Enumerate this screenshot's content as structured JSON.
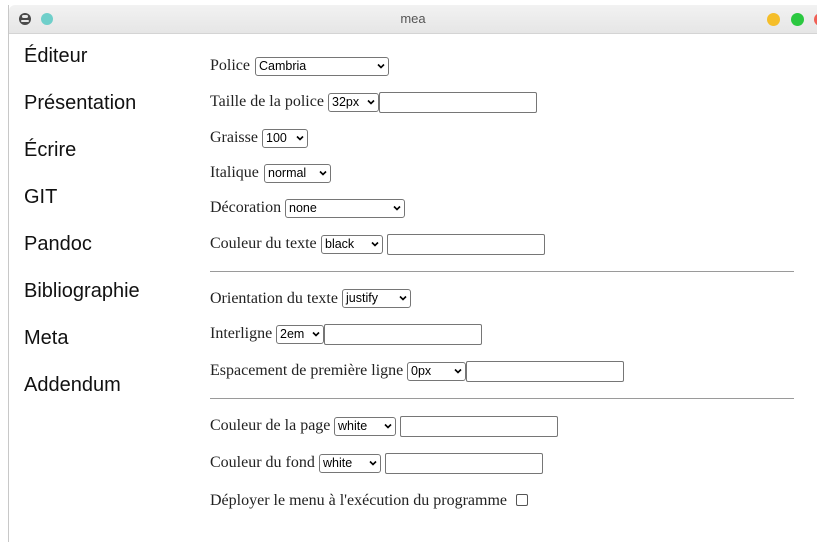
{
  "window": {
    "title": "mea"
  },
  "sidebar": {
    "items": [
      {
        "label": "Éditeur"
      },
      {
        "label": "Présentation"
      },
      {
        "label": "Écrire"
      },
      {
        "label": "GIT"
      },
      {
        "label": "Pandoc"
      },
      {
        "label": "Bibliographie"
      },
      {
        "label": "Meta"
      },
      {
        "label": "Addendum"
      }
    ]
  },
  "form": {
    "police": {
      "label": "Police",
      "value": "Cambria"
    },
    "taille": {
      "label": "Taille de la police",
      "value": "32px",
      "text": ""
    },
    "graisse": {
      "label": "Graisse",
      "value": "100"
    },
    "italique": {
      "label": "Italique",
      "value": "normal"
    },
    "decoration": {
      "label": "Décoration",
      "value": "none"
    },
    "couleur_texte": {
      "label": "Couleur du texte",
      "value": "black",
      "text": ""
    },
    "orientation": {
      "label": "Orientation du texte",
      "value": "justify"
    },
    "interligne": {
      "label": "Interligne",
      "value": "2em",
      "text": ""
    },
    "espacement": {
      "label": "Espacement de première ligne",
      "value": "0px",
      "text": ""
    },
    "couleur_page": {
      "label": "Couleur de la page",
      "value": "white",
      "text": ""
    },
    "couleur_fond": {
      "label": "Couleur du fond",
      "value": "white",
      "text": ""
    },
    "deployer": {
      "label": "Déployer le menu à l'exécution du programme",
      "checked": false
    }
  },
  "colors": {
    "title_bar": "#ececec",
    "control_yellow": "#f5be2a",
    "control_green": "#2bc840",
    "control_red": "#f05f55",
    "accent_teal": "#6fcfca"
  },
  "icons": {
    "app": "globe-icon",
    "select_arrow": "chevron-down-icon"
  }
}
